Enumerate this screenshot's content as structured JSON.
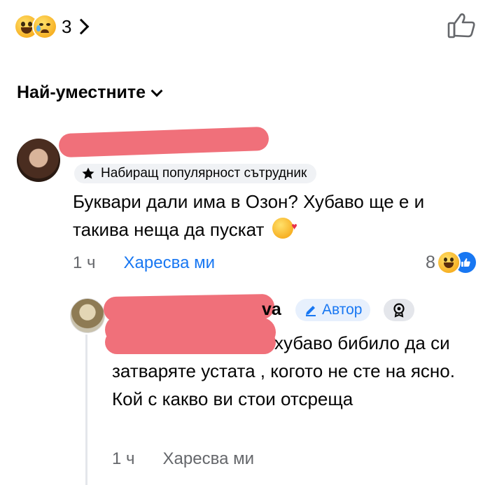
{
  "reactions": {
    "count": "3",
    "icons": [
      "grinning-emoji",
      "sad-emoji",
      "chevron-right-icon"
    ]
  },
  "like_button": {
    "icon": "thumbs-up-icon"
  },
  "sort": {
    "label": "Най-уместните",
    "icon": "chevron-down-icon"
  },
  "comment1": {
    "badge": "Набиращ популярност сътрудник",
    "text": "Буквари дали има в Озон? Хубаво ще е и такива неща да пускат",
    "time": "1 ч",
    "like": "Харесва ми",
    "reaction_count": "8"
  },
  "reply": {
    "name_tail": "va",
    "author_badge": "Автор",
    "text": "хубаво бибило да си затваряте устата , когото не сте на ясно. Кой с какво ви стои отсреща",
    "time": "1 ч",
    "like": "Харесва ми"
  },
  "colors": {
    "accent": "#1877f2",
    "muted": "#65676b",
    "redaction": "#f0707a"
  }
}
